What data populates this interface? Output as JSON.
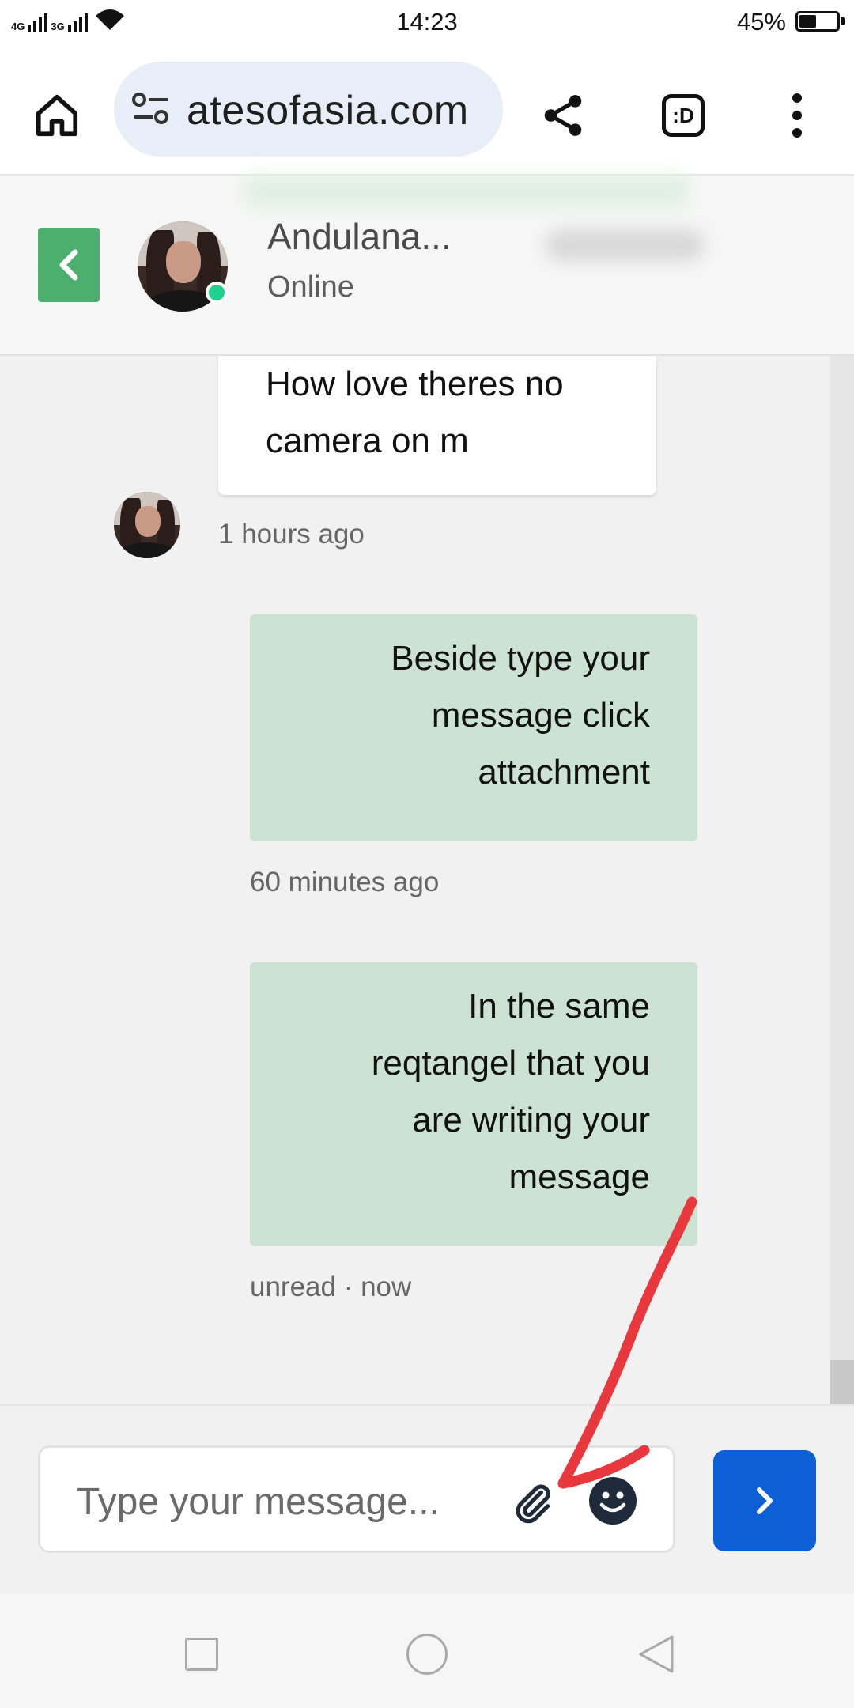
{
  "status_bar": {
    "network_1": "4G",
    "network_2": "3G",
    "time": "14:23",
    "battery_percent": "45%",
    "battery_level": 0.45
  },
  "browser": {
    "url": "atesofasia.com",
    "icons": {
      "home": "home-icon",
      "site_settings": "tune-icon",
      "share": "share-icon",
      "tab_switcher": "tab-switcher-icon",
      "menu": "more-vert-icon"
    },
    "tab_badge": ":D"
  },
  "chat_header": {
    "contact_name": "Andulana...",
    "status": "Online",
    "back_icon": "chevron-left-icon",
    "back_color": "#4caf6e",
    "online_color": "#1fd08e"
  },
  "messages": [
    {
      "direction": "incoming",
      "lines": [
        "How love theres no",
        "camera on m"
      ],
      "meta": "1 hours ago"
    },
    {
      "direction": "outgoing",
      "lines": [
        "Beside type your",
        "message click",
        "attachment"
      ],
      "meta": "60 minutes ago"
    },
    {
      "direction": "outgoing",
      "lines": [
        "In the same",
        "reqtangel that you",
        "are writing your",
        "message"
      ],
      "meta": "unread · now"
    }
  ],
  "composer": {
    "placeholder": "Type your message...",
    "attach_icon": "paperclip-icon",
    "emoji_icon": "smiley-icon",
    "send_icon": "chevron-right-icon",
    "send_color": "#0d5fd6"
  },
  "annotation": {
    "color": "#e8383d"
  },
  "navbar": {
    "recent": "square-icon",
    "home": "circle-icon",
    "back": "triangle-back-icon"
  }
}
